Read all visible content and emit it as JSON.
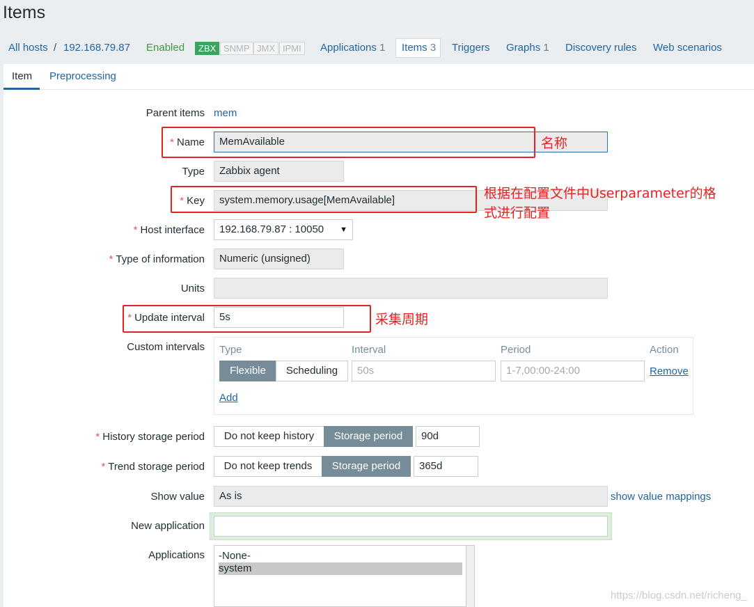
{
  "page": {
    "title": "Items"
  },
  "breadcrumb": {
    "all_hosts": "All hosts",
    "separator": "/",
    "host": "192.168.79.87",
    "status": "Enabled",
    "badges": [
      "ZBX",
      "SNMP",
      "JMX",
      "IPMI"
    ],
    "nav": [
      {
        "label": "Applications",
        "count": "1"
      },
      {
        "label": "Items",
        "count": "3"
      },
      {
        "label": "Triggers",
        "count": ""
      },
      {
        "label": "Graphs",
        "count": "1"
      },
      {
        "label": "Discovery rules",
        "count": ""
      },
      {
        "label": "Web scenarios",
        "count": ""
      }
    ]
  },
  "subtabs": {
    "item": "Item",
    "preprocessing": "Preprocessing"
  },
  "form": {
    "parent_items": {
      "label": "Parent items",
      "value": "mem"
    },
    "name": {
      "label": "Name",
      "value": "MemAvailable"
    },
    "type": {
      "label": "Type",
      "value": "Zabbix agent"
    },
    "key": {
      "label": "Key",
      "value": "system.memory.usage[MemAvailable]"
    },
    "host_interface": {
      "label": "Host interface",
      "value": "192.168.79.87 : 10050"
    },
    "type_of_information": {
      "label": "Type of information",
      "value": "Numeric (unsigned)"
    },
    "units": {
      "label": "Units",
      "value": ""
    },
    "update_interval": {
      "label": "Update interval",
      "value": "5s"
    },
    "custom_intervals": {
      "label": "Custom intervals",
      "headers": {
        "type": "Type",
        "interval": "Interval",
        "period": "Period",
        "action": "Action"
      },
      "flexible": "Flexible",
      "scheduling": "Scheduling",
      "interval_placeholder": "50s",
      "period_placeholder": "1-7,00:00-24:00",
      "remove": "Remove",
      "add": "Add"
    },
    "history": {
      "label": "History storage period",
      "no_keep": "Do not keep history",
      "storage": "Storage period",
      "value": "90d"
    },
    "trend": {
      "label": "Trend storage period",
      "no_keep": "Do not keep trends",
      "storage": "Storage period",
      "value": "365d"
    },
    "show_value": {
      "label": "Show value",
      "value": "As is",
      "link": "show value mappings"
    },
    "new_application": {
      "label": "New application",
      "value": ""
    },
    "applications": {
      "label": "Applications",
      "options": [
        "-None-",
        "system"
      ],
      "selected": "system"
    }
  },
  "annotations": {
    "name": "名称",
    "key_line1": "根据在配置文件中Userparameter的格",
    "key_line2": "式进行配置",
    "interval": "采集周期"
  },
  "watermark": "https://blog.csdn.net/richeng_",
  "colors": {
    "link": "#1f65a2",
    "required": "#e45959",
    "annotation": "#e52222",
    "enabled": "#3a9c3a",
    "segment_active": "#768d99"
  }
}
